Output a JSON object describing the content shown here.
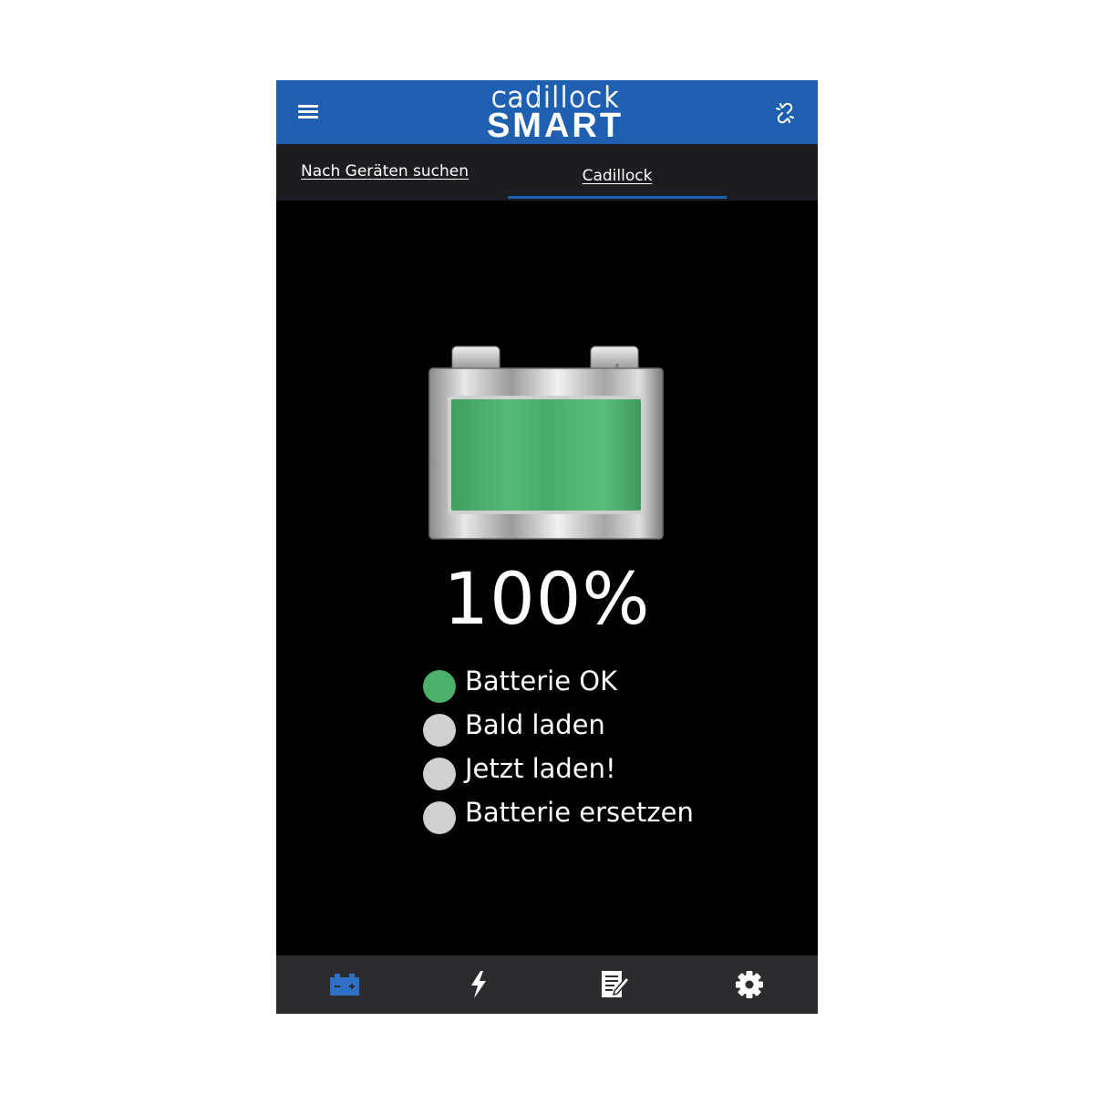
{
  "app": {
    "logo_top": "cadillock",
    "logo_bottom": "SMART"
  },
  "header": {
    "menu_icon": "hamburger-menu-icon",
    "link_icon": "broken-link-icon"
  },
  "tabs": [
    {
      "label": "Nach Geräten suchen",
      "active": false
    },
    {
      "label": "Cadillock",
      "active": true
    }
  ],
  "battery": {
    "charge_percent": 100,
    "percent_text": "100%",
    "minus_symbol": "−",
    "plus_symbol": "+",
    "fill_color": "#4caf6a"
  },
  "status": [
    {
      "label": "Batterie OK",
      "active": true
    },
    {
      "label": "Bald laden",
      "active": false
    },
    {
      "label": "Jetzt laden!",
      "active": false
    },
    {
      "label": "Batterie ersetzen",
      "active": false
    }
  ],
  "bottom_nav": [
    {
      "icon": "battery-icon",
      "active": true
    },
    {
      "icon": "lightning-icon",
      "active": false
    },
    {
      "icon": "notes-edit-icon",
      "active": false
    },
    {
      "icon": "gear-icon",
      "active": false
    }
  ],
  "colors": {
    "accent": "#1f5fb0",
    "status_active": "#4caf6a",
    "status_inactive": "#d0d0d0",
    "background": "#000000"
  }
}
